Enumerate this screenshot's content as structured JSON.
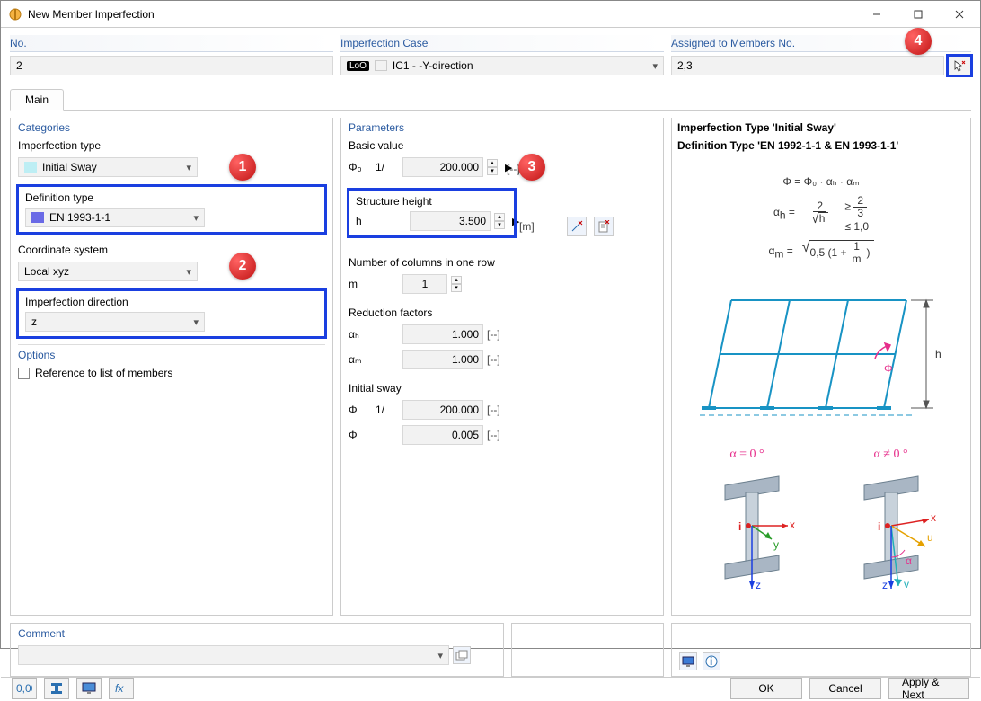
{
  "window": {
    "title": "New Member Imperfection"
  },
  "header": {
    "no_label": "No.",
    "no_value": "2",
    "case_label": "Imperfection Case",
    "case_badge": "LoO",
    "case_value": "IC1 - -Y-direction",
    "assigned_label": "Assigned to Members No.",
    "assigned_value": "2,3"
  },
  "tabs": {
    "main": "Main"
  },
  "categories": {
    "title": "Categories",
    "imp_type_label": "Imperfection type",
    "imp_type_value": "Initial Sway",
    "def_type_label": "Definition type",
    "def_type_value": "EN 1993-1-1",
    "coord_label": "Coordinate system",
    "coord_value": "Local xyz",
    "dir_label": "Imperfection direction",
    "dir_value": "z"
  },
  "options": {
    "title": "Options",
    "ref_list": "Reference to list of members"
  },
  "parameters": {
    "title": "Parameters",
    "basic_value": "Basic value",
    "phi0_sym": "Φ₀",
    "phi0_pre": "1/",
    "phi0_val": "200.000",
    "phi0_unit": "[--]",
    "struct_h": "Structure height",
    "h_sym": "h",
    "h_val": "3.500",
    "h_unit": "[m]",
    "cols_label": "Number of columns in one row",
    "m_sym": "m",
    "m_val": "1",
    "red_label": "Reduction factors",
    "ah_sym": "αₕ",
    "ah_val": "1.000",
    "ah_unit": "[--]",
    "am_sym": "αₘ",
    "am_val": "1.000",
    "am_unit": "[--]",
    "init_sway": "Initial sway",
    "phi_sym": "Φ",
    "phi_pre": "1/",
    "phi_val": "200.000",
    "phi_unit": "[--]",
    "phi2_val": "0.005",
    "phi2_unit": "[--]"
  },
  "info": {
    "line1": "Imperfection Type 'Initial Sway'",
    "line2": "Definition Type 'EN 1992-1-1 & EN 1993-1-1'",
    "eq1": "Φ = Φ₀ · αₕ · αₘ",
    "ah_ge": "≥",
    "ah_ge_n": "2",
    "ah_ge_d": "3",
    "ah_le": "≤ 1,0",
    "am_text": "0,5 (1 + 1/m)",
    "alpha0": "α = 0 °",
    "alphan0": "α ≠ 0 °"
  },
  "comment": {
    "title": "Comment"
  },
  "footer": {
    "ok": "OK",
    "cancel": "Cancel",
    "apply": "Apply & Next"
  },
  "callouts": {
    "c1": "1",
    "c2": "2",
    "c3": "3",
    "c4": "4"
  }
}
